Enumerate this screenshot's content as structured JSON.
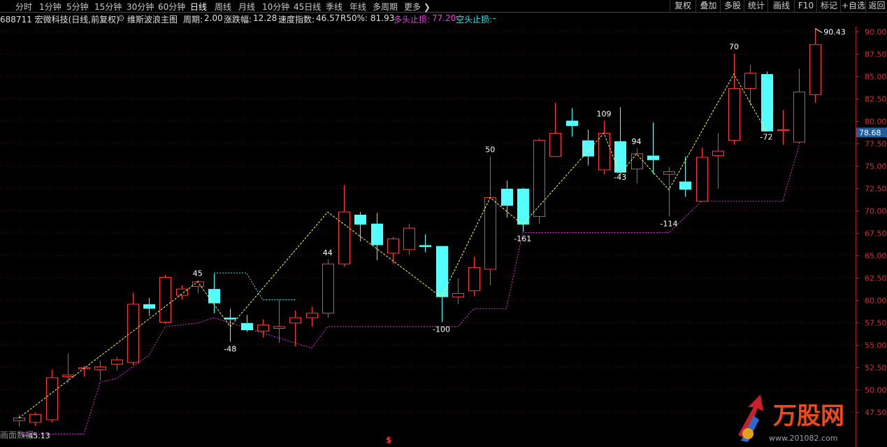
{
  "toolbar": {
    "periods": [
      "分时",
      "1分钟",
      "5分钟",
      "15分钟",
      "30分钟",
      "60分钟",
      "日线",
      "周线",
      "月线",
      "10分钟",
      "45日线",
      "季线",
      "年线",
      "多周期",
      "更多"
    ],
    "active_period": "日线",
    "right_buttons": [
      "复权",
      "叠加",
      "多股",
      "统计",
      "画线",
      "F10",
      "标记",
      "+自选",
      "返回"
    ]
  },
  "info": {
    "stock": "688711 宏微科技(日线,前复权)",
    "indicator_name": "维斯波浪主图",
    "cycle_label": "周期:",
    "cycle_value": "2.00",
    "change_label": "涨跌幅:",
    "change_value": "12.28",
    "speed_label": "速度指数:",
    "speed_value": "46.57",
    "r50_label": "R50%:",
    "r50_value": "81.93",
    "long_stop_label": "多头止损:",
    "long_stop_value": "77.20",
    "short_stop_label": "空头止损:",
    "short_stop_value": "-"
  },
  "colors": {
    "up": "#ff3b3b",
    "down": "#54ffff",
    "grid": "#5a0000",
    "wave": "#ffff4c",
    "stop_long": "#d633d6",
    "stop_short": "#54e0e0",
    "axis_text": "#cc3333",
    "price_tag_bg": "#1f5f9f"
  },
  "chart_data": {
    "type": "candlestick",
    "yaxis": {
      "min": 45.0,
      "max": 91.0,
      "ticks": [
        "90.00",
        "87.50",
        "85.00",
        "82.50",
        "80.00",
        "77.50",
        "75.00",
        "72.50",
        "70.00",
        "67.50",
        "65.00",
        "62.50",
        "60.00",
        "57.50",
        "55.00",
        "52.50",
        "50.00",
        "47.50"
      ]
    },
    "current_price": "78.68",
    "high_label": "90.43",
    "low_label": "45.13",
    "candles": [
      [
        46.5,
        47.2,
        45.8,
        46.8
      ],
      [
        46.3,
        47.4,
        45.9,
        47.2
      ],
      [
        46.6,
        52.2,
        46.3,
        51.3
      ],
      [
        51.4,
        54.0,
        50.7,
        51.6
      ],
      [
        52.3,
        52.6,
        51.4,
        52.4
      ],
      [
        52.2,
        53.2,
        51.0,
        52.5
      ],
      [
        52.8,
        53.6,
        52.1,
        53.3
      ],
      [
        53.0,
        60.8,
        52.7,
        59.5
      ],
      [
        59.5,
        60.2,
        58.2,
        59.0
      ],
      [
        57.5,
        62.8,
        57.3,
        62.5
      ],
      [
        60.5,
        61.6,
        60.0,
        61.2
      ],
      [
        61.5,
        62.2,
        60.7,
        62.0
      ],
      [
        61.2,
        62.9,
        58.5,
        59.6
      ],
      [
        58.0,
        59.0,
        55.3,
        57.8
      ],
      [
        57.4,
        58.3,
        56.4,
        56.6
      ],
      [
        56.5,
        57.8,
        55.8,
        57.2
      ],
      [
        56.8,
        60.0,
        55.2,
        57.0
      ],
      [
        57.4,
        58.8,
        54.8,
        58.0
      ],
      [
        58.0,
        59.2,
        57.0,
        58.5
      ],
      [
        58.5,
        64.5,
        58.0,
        64.0
      ],
      [
        64.0,
        72.8,
        63.7,
        69.8
      ],
      [
        69.5,
        69.8,
        66.5,
        68.4
      ],
      [
        68.5,
        69.7,
        64.4,
        66.1
      ],
      [
        65.2,
        67.0,
        64.0,
        66.8
      ],
      [
        65.6,
        68.5,
        65.0,
        68.0
      ],
      [
        66.1,
        67.3,
        65.3,
        65.9
      ],
      [
        66.0,
        65.6,
        57.5,
        60.3
      ],
      [
        60.3,
        62.4,
        59.5,
        60.7
      ],
      [
        61.0,
        64.8,
        60.4,
        63.6
      ],
      [
        63.4,
        76.0,
        61.6,
        71.4
      ],
      [
        72.4,
        73.3,
        69.2,
        70.5
      ],
      [
        72.4,
        72.5,
        67.6,
        68.4
      ],
      [
        69.3,
        78.0,
        68.5,
        77.8
      ],
      [
        76.0,
        82.0,
        76.0,
        78.6
      ],
      [
        80.0,
        81.4,
        78.2,
        79.4
      ],
      [
        77.8,
        79.0,
        75.0,
        76.0
      ],
      [
        74.5,
        80.0,
        74.0,
        78.6
      ],
      [
        77.7,
        81.5,
        74.5,
        74.2
      ],
      [
        74.6,
        76.9,
        73.0,
        76.3
      ],
      [
        76.1,
        79.8,
        74.0,
        75.6
      ],
      [
        74.0,
        74.8,
        69.3,
        74.3
      ],
      [
        73.2,
        76.0,
        71.5,
        72.3
      ],
      [
        71.0,
        77.0,
        71.0,
        75.9
      ],
      [
        76.1,
        78.6,
        72.4,
        76.6
      ],
      [
        77.8,
        87.5,
        77.3,
        83.6
      ],
      [
        83.6,
        86.2,
        81.7,
        85.3
      ],
      [
        85.2,
        85.5,
        79.0,
        78.8
      ],
      [
        78.9,
        81.2,
        77.3,
        79.0
      ],
      [
        77.6,
        85.8,
        77.4,
        83.2
      ],
      [
        82.9,
        90.3,
        82.0,
        88.5
      ]
    ],
    "wave_labels": [
      {
        "index": 11,
        "text": "45",
        "pos": "above"
      },
      {
        "index": 13,
        "text": "-48",
        "pos": "below"
      },
      {
        "index": 19,
        "text": "44",
        "pos": "above"
      },
      {
        "index": 26,
        "text": "-100",
        "pos": "below"
      },
      {
        "index": 29,
        "text": "50",
        "pos": "above"
      },
      {
        "index": 31,
        "text": "-161",
        "pos": "below"
      },
      {
        "index": 36,
        "text": "109",
        "pos": "above"
      },
      {
        "index": 37,
        "text": "-43",
        "pos": "below"
      },
      {
        "index": 38,
        "text": "94",
        "pos": "above"
      },
      {
        "index": 40,
        "text": "-114",
        "pos": "below"
      },
      {
        "index": 44,
        "text": "70",
        "pos": "above"
      },
      {
        "index": 46,
        "text": "-72",
        "pos": "below"
      }
    ],
    "wave_points": [
      [
        0,
        46.8
      ],
      [
        11,
        62.0
      ],
      [
        13,
        57.0
      ],
      [
        19,
        69.8
      ],
      [
        26,
        60.3
      ],
      [
        29,
        71.4
      ],
      [
        31,
        68.4
      ],
      [
        36,
        78.6
      ],
      [
        37,
        74.0
      ],
      [
        38,
        76.3
      ],
      [
        40,
        72.3
      ],
      [
        44,
        85.2
      ],
      [
        46,
        78.8
      ]
    ],
    "long_stop": [
      [
        0,
        45.0
      ],
      [
        4,
        45.0
      ],
      [
        5,
        50.8
      ],
      [
        6,
        51.2
      ],
      [
        8,
        53.8
      ],
      [
        9,
        57.0
      ],
      [
        10,
        57.2
      ],
      [
        11,
        57.4
      ],
      [
        12,
        58.0
      ],
      [
        18,
        54.6
      ],
      [
        19,
        57.0
      ],
      [
        20,
        57.0
      ],
      [
        27,
        57.0
      ],
      [
        28,
        59.0
      ],
      [
        29,
        59.0
      ],
      [
        30,
        59.0
      ],
      [
        31,
        67.5
      ],
      [
        40,
        67.5
      ],
      [
        42,
        71.0
      ],
      [
        47,
        71.0
      ],
      [
        48,
        77.2
      ]
    ],
    "short_stop": [
      [
        12,
        63.0
      ],
      [
        14,
        63.0
      ],
      [
        15,
        60.0
      ],
      [
        17,
        60.0
      ]
    ]
  },
  "footer": {
    "label": "画面数据",
    "marker": "$"
  },
  "watermark": {
    "brand": "万股网",
    "url": "www.201082.com"
  }
}
